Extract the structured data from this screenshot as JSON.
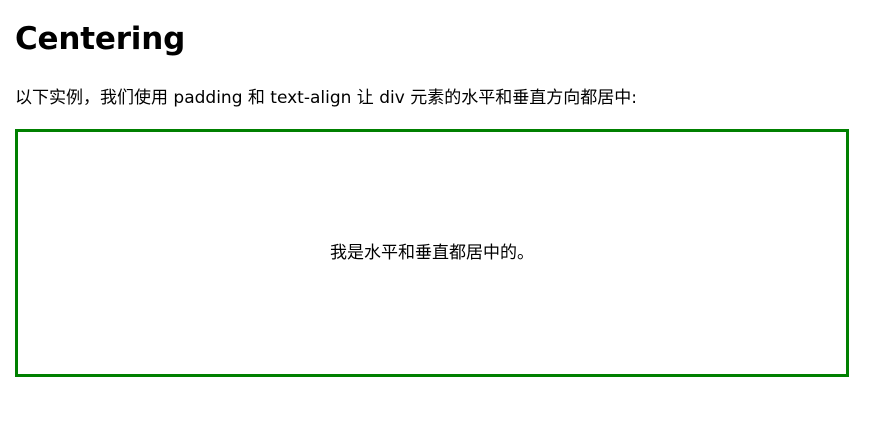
{
  "heading": "Centering",
  "intro_text": "以下实例，我们使用 padding 和 text-align 让 div 元素的水平和垂直方向都居中:",
  "box": {
    "text": "我是水平和垂直都居中的。",
    "border_color": "#008000"
  }
}
